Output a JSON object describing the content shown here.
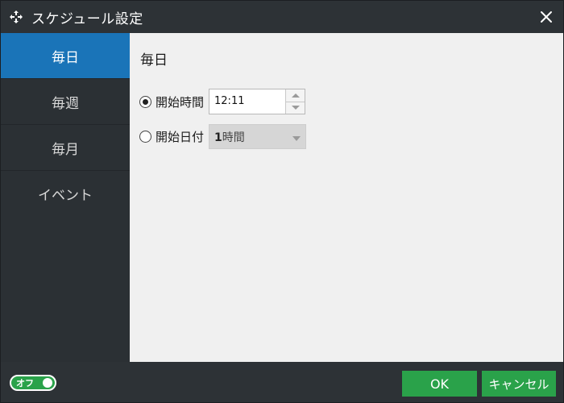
{
  "window": {
    "title": "スケジュール設定"
  },
  "sidebar": {
    "items": [
      {
        "label": "毎日",
        "active": true
      },
      {
        "label": "毎週",
        "active": false
      },
      {
        "label": "毎月",
        "active": false
      },
      {
        "label": "イベント",
        "active": false
      }
    ]
  },
  "content": {
    "section_title": "毎日",
    "start_time": {
      "label": "開始時間",
      "selected": true,
      "value": "12:11"
    },
    "start_date": {
      "label": "開始日付",
      "selected": false,
      "interval_number": "1",
      "interval_unit": "時間"
    }
  },
  "footer": {
    "toggle_label": "オフ",
    "ok_label": "OK",
    "cancel_label": "キャンセル"
  },
  "colors": {
    "accent": "#1a74b8",
    "green": "#2aa24a",
    "dark": "#2b3034",
    "panel": "#f0f0f0"
  },
  "icons": {
    "app": "app-logo-icon",
    "close": "close-icon",
    "spin_up": "arrow-up-icon",
    "spin_down": "arrow-down-icon",
    "dropdown": "chevron-down-icon"
  }
}
